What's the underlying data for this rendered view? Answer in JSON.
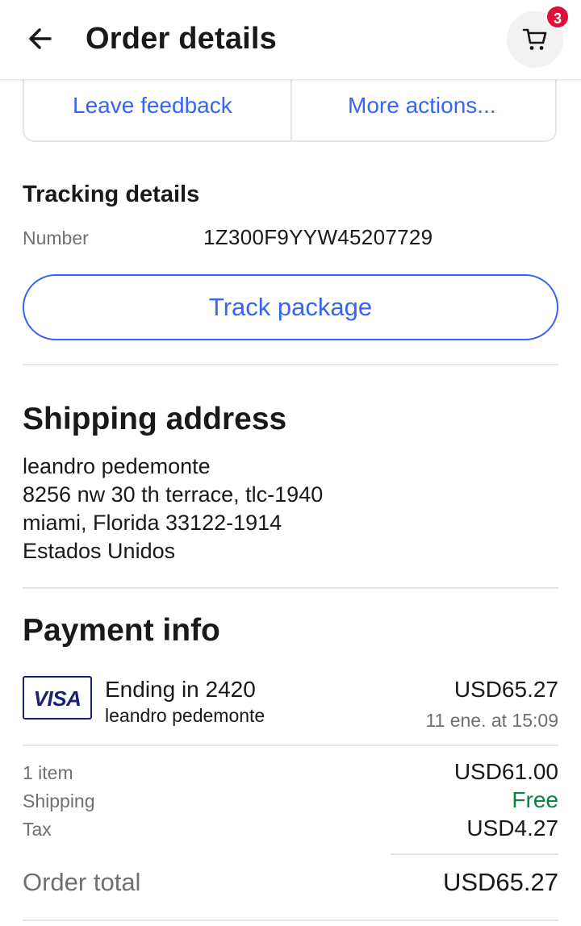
{
  "header": {
    "title": "Order details",
    "cart_count": "3"
  },
  "actions": {
    "leave_feedback": "Leave feedback",
    "more_actions": "More actions..."
  },
  "tracking": {
    "title": "Tracking details",
    "number_label": "Number",
    "number_value": "1Z300F9YYW45207729",
    "track_button": "Track package"
  },
  "shipping": {
    "title": "Shipping address",
    "lines": [
      "leandro pedemonte",
      "8256 nw 30 th terrace, tlc-1940",
      "miami, Florida 33122-1914",
      "Estados Unidos"
    ]
  },
  "payment": {
    "title": "Payment info",
    "card_brand": "VISA",
    "card_ending": "Ending in 2420",
    "card_holder": "leandro pedemonte",
    "amount": "USD65.27",
    "date": "11 ene. at 15:09"
  },
  "summary": {
    "items_label": "1 item",
    "items_value": "USD61.00",
    "shipping_label": "Shipping",
    "shipping_value": "Free",
    "tax_label": "Tax",
    "tax_value": "USD4.27",
    "total_label": "Order total",
    "total_value": "USD65.27"
  },
  "colors": {
    "accent_blue": "#3665f3",
    "badge_red": "#e0103a",
    "free_green": "#05823f",
    "visa_navy": "#1a1f71"
  }
}
